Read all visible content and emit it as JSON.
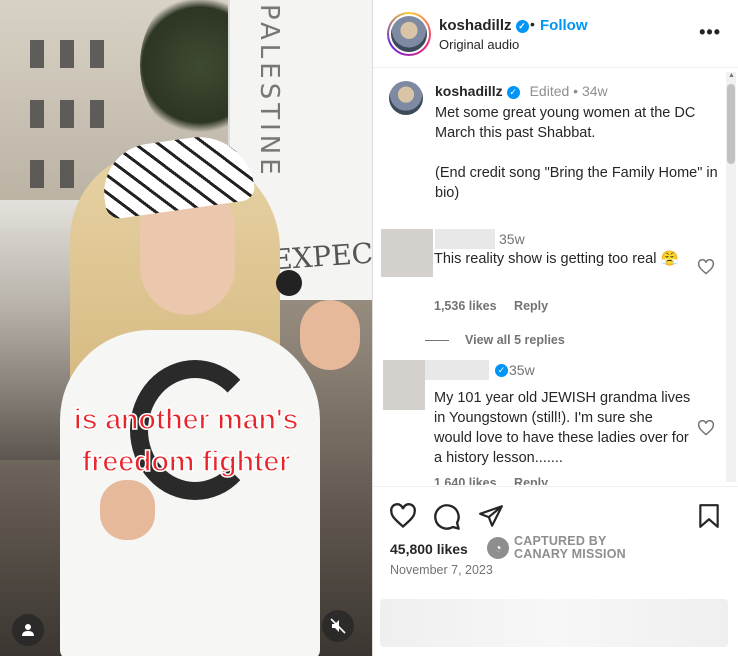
{
  "video": {
    "sign_text": "PALESTINE",
    "sign2_text": "EXPEC",
    "caption_line1": "is another man's",
    "caption_line2": "freedom fighter",
    "user_icon": "user-icon",
    "mute_icon": "audio-muted-icon"
  },
  "header": {
    "username": "koshadillz",
    "dot": "•",
    "follow_label": "Follow",
    "subtitle": "Original audio",
    "more_icon": "more-options-icon"
  },
  "caption": {
    "username": "koshadillz",
    "edited": "Edited",
    "time": "34w",
    "line1": "Met some great young women at the DC March this past Shabbat.",
    "line2": "(End credit song \"Bring the Family Home\" in bio)"
  },
  "comments": [
    {
      "time": "35w",
      "text": "This reality show is getting too real 😤",
      "likes": "1,536 likes",
      "reply": "Reply"
    },
    {
      "time": "35w",
      "text": "My 101 year old JEWISH grandma lives in Youngstown (still!). I'm sure she would love to have these ladies over for a history lesson.......",
      "likes": "1,640 likes",
      "reply": "Reply"
    }
  ],
  "view_replies": "View all 5 replies",
  "actions": {
    "likes": "45,800 likes",
    "date": "November 7, 2023"
  },
  "watermark": {
    "line1": "CAPTURED BY",
    "line2": "CANARY MISSION"
  },
  "colors": {
    "accent": "#0095f6",
    "caption_red": "#e6262c",
    "text": "#262626",
    "muted": "#737373"
  }
}
